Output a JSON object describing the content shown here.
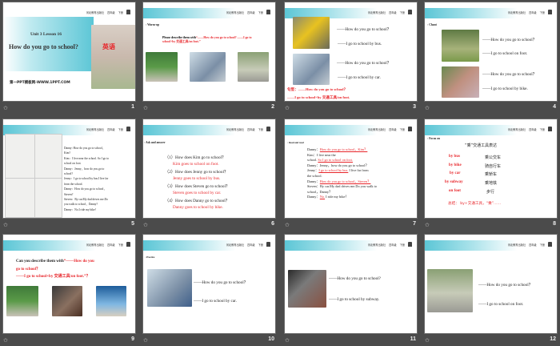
{
  "header": {
    "publisher": "河北教育出版社",
    "grade": "四年级",
    "volume": "下册"
  },
  "slides": [
    {
      "num": "1",
      "lesson": "Unit 3 Lesson 16",
      "title": "How do you go to school?",
      "site": "第一PPT模板网-WWW.1PPT.COM",
      "book": "英语"
    },
    {
      "num": "2",
      "section": "Warm-up",
      "prompt_black": "Please describe them with",
      "prompt_red": "“——How do you go to school? ——I go to school+by 交通工具/on foot.”"
    },
    {
      "num": "3",
      "q1": "——How  do you go to school？",
      "a1": "——I go to school by bus.",
      "q2": "——How  do you go to school？",
      "a2": "——I go to school by car.",
      "pattern1": "句型：——How  do  you  go  to school？",
      "pattern2": "——I  go to school+by  交通工具/on foot."
    },
    {
      "num": "4",
      "section": "Chant",
      "q1": "——How  do you go to school？",
      "a1": "——I go to school on foot.",
      "q2": "——How  do you go to school？",
      "a2": "——I go to school by bike."
    },
    {
      "num": "5",
      "lines": [
        "Danny:  How  do you go to school，",
        "Kim?",
        "Kim：I live near  the school. So I go to",
        "school on foot.",
        "Danny：Jenny，how  do you go to",
        "school?",
        "Jenny：I go to school by bus.I live far",
        "from  the school.",
        "Danny：How  do you go to school，",
        "Steven?",
        "Steven：By car.My  dad drives me.Do",
        "you walk to school，Danny?",
        "Danny：No.I ride my bike!"
      ]
    },
    {
      "num": "6",
      "section": "Ask and answer",
      "qa": [
        {
          "q": "（1）How  does Kim  go to school？",
          "a": "Kim  goes to school on foot."
        },
        {
          "q": "（2）How  does Jenny go to school？",
          "a": "Jenny goes to school by bus."
        },
        {
          "q": "（3）How  does Steven go to school？",
          "a": "Steven goes to school by car."
        },
        {
          "q": "（4）How  does Danny go to school？",
          "a": "Danny goes to school by bike."
        }
      ]
    },
    {
      "num": "7",
      "section": "Read and read",
      "l1a": "Danny：",
      "l1b": "How do you go to school，Kim？",
      "l2": "Kim：I live near the",
      "l3a": "school.",
      "l3b": "So I go to school on foot.",
      "l4": "Danny：Jenny，how do you go to school？",
      "l5a": "Jenny：",
      "l5b": "I go to school by bus.",
      "l5c": "I live far from",
      "l6": "the school.",
      "l7a": "Danny：",
      "l7b": "How do you go to school，Steven？",
      "l8": "Steven：By car.My dad drives me.Do you walk to",
      "l9": "school，Danny？",
      "l10a": "Danny：",
      "l10b": "No.",
      "l10c": "I ride my bike！"
    },
    {
      "num": "8",
      "section": "Focus on",
      "title": "“乘”交通工具表达",
      "en": [
        "by bus",
        "by bike",
        "by car",
        "by subway",
        "on foot"
      ],
      "cn": [
        "乘公交车",
        "骑自行车",
        "乘轿车",
        "乘地铁",
        "步行"
      ],
      "summary": "总结： by+交通工具，“乘”……"
    },
    {
      "num": "9",
      "prompt_black": "Can you describe them with",
      "prompt_red1": "“——How do you",
      "prompt_red2": "go to school？",
      "prompt_red3": "——I go to school+by 交通工具/on foot.”？"
    },
    {
      "num": "10",
      "section": "Practice",
      "q": "——How  do you go to school？",
      "a": "——I go to school by car."
    },
    {
      "num": "11",
      "q": "——How  do you go to school?",
      "a": "——I go to school by subway."
    },
    {
      "num": "12",
      "q": "——How  do you go to school？",
      "a": "——I go to school on foot."
    }
  ]
}
